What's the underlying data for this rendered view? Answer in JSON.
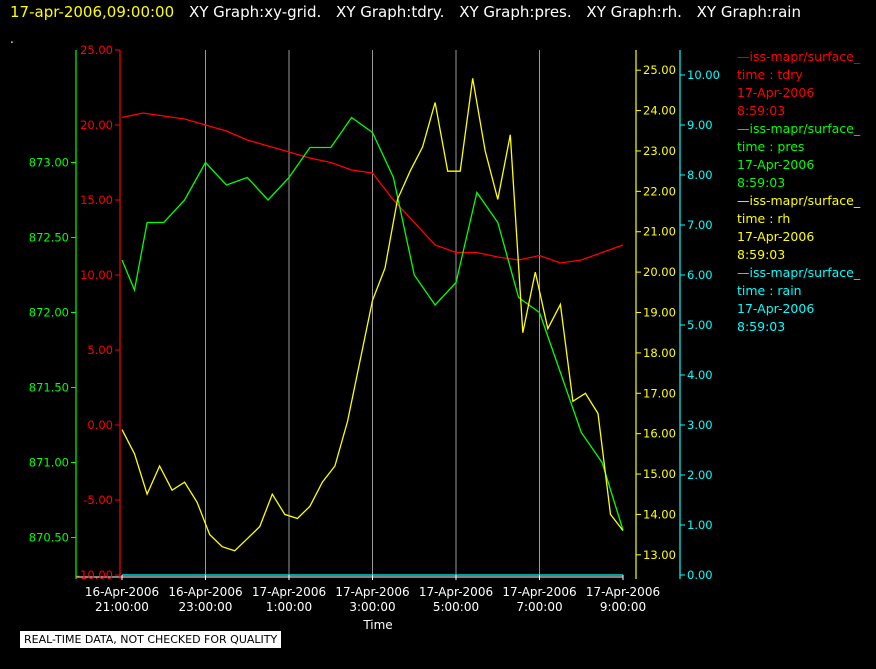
{
  "header": {
    "timestamp": "17-apr-2006,09:00:00",
    "graphs": [
      "XY Graph:xy-grid.",
      "XY Graph:tdry.",
      "XY Graph:pres.",
      "XY Graph:rh.",
      "XY Graph:rain"
    ],
    "subline": "."
  },
  "footer": {
    "quality_note": "REAL-TIME DATA, NOT CHECKED FOR QUALITY"
  },
  "colors": {
    "tdry": "#ff0000",
    "pres": "#00ff00",
    "rh": "#ffff00",
    "rain": "#00ffff",
    "grid": "#999999",
    "axis_text": "#ffffff"
  },
  "legend": [
    {
      "series": "tdry",
      "lines": [
        "—iss-mapr/surface_",
        "time : tdry",
        "17-Apr-2006",
        "8:59:03"
      ]
    },
    {
      "series": "pres",
      "lines": [
        "—iss-mapr/surface_",
        "time : pres",
        "17-Apr-2006",
        "8:59:03"
      ]
    },
    {
      "series": "rh",
      "lines": [
        "—iss-mapr/surface_",
        "time : rh",
        "17-Apr-2006",
        "8:59:03"
      ]
    },
    {
      "series": "rain",
      "lines": [
        "—iss-mapr/surface_",
        "time : rain",
        "17-Apr-2006",
        "8:59:03"
      ]
    }
  ],
  "chart_data": {
    "type": "line",
    "xlabel": "Time",
    "x_ticks": [
      [
        "16-Apr-2006",
        "21:00:00"
      ],
      [
        "16-Apr-2006",
        "23:00:00"
      ],
      [
        "17-Apr-2006",
        "1:00:00"
      ],
      [
        "17-Apr-2006",
        "3:00:00"
      ],
      [
        "17-Apr-2006",
        "5:00:00"
      ],
      [
        "17-Apr-2006",
        "7:00:00"
      ],
      [
        "17-Apr-2006",
        "9:00:00"
      ]
    ],
    "x_range_hours": [
      0,
      12
    ],
    "axes": {
      "pres": {
        "ylim": [
          870.25,
          873.75
        ],
        "ticks": [
          "870.50",
          "871.00",
          "871.50",
          "872.00",
          "872.50",
          "873.00"
        ]
      },
      "tdry": {
        "ylim": [
          -10,
          25
        ],
        "ticks": [
          "-10.00",
          "-5.00",
          "0.00",
          "5.00",
          "10.00",
          "15.00",
          "20.00",
          "25.00"
        ]
      },
      "rh": {
        "ylim": [
          12.5,
          25.5
        ],
        "ticks": [
          "13.00",
          "14.00",
          "15.00",
          "16.00",
          "17.00",
          "18.00",
          "19.00",
          "20.00",
          "21.00",
          "22.00",
          "23.00",
          "24.00",
          "25.00"
        ]
      },
      "rain": {
        "ylim": [
          0,
          10.5
        ],
        "ticks": [
          "0.00",
          "1.00",
          "2.00",
          "3.00",
          "4.00",
          "5.00",
          "6.00",
          "7.00",
          "8.00",
          "9.00",
          "10.00"
        ]
      }
    },
    "grid": true,
    "series": [
      {
        "name": "tdry",
        "axis": "tdry",
        "x": [
          0,
          0.5,
          1,
          1.5,
          2,
          2.5,
          3,
          3.5,
          4,
          4.5,
          5,
          5.5,
          6,
          6.5,
          7,
          7.5,
          8,
          8.5,
          9,
          9.5,
          10,
          10.5,
          11,
          11.5,
          12
        ],
        "values": [
          20.5,
          20.8,
          20.6,
          20.4,
          20.0,
          19.6,
          19.0,
          18.6,
          18.2,
          17.8,
          17.5,
          17.0,
          16.8,
          15.0,
          13.5,
          12.0,
          11.5,
          11.5,
          11.2,
          11.0,
          11.3,
          10.8,
          11.0,
          11.5,
          12.0
        ]
      },
      {
        "name": "pres",
        "axis": "pres",
        "x": [
          0,
          0.3,
          0.6,
          1,
          1.5,
          2,
          2.5,
          3,
          3.5,
          4,
          4.5,
          5,
          5.5,
          6,
          6.5,
          7,
          7.5,
          8,
          8.5,
          9,
          9.5,
          10,
          10.5,
          11,
          11.5,
          12
        ],
        "values": [
          872.35,
          872.15,
          872.6,
          872.6,
          872.75,
          873.0,
          872.85,
          872.9,
          872.75,
          872.9,
          873.1,
          873.1,
          873.3,
          873.2,
          872.9,
          872.25,
          872.05,
          872.2,
          872.8,
          872.6,
          872.1,
          872.0,
          871.6,
          871.2,
          871.0,
          870.55
        ]
      },
      {
        "name": "rh",
        "axis": "rh",
        "x": [
          0,
          0.3,
          0.6,
          0.9,
          1.2,
          1.5,
          1.8,
          2.1,
          2.4,
          2.7,
          3,
          3.3,
          3.6,
          3.9,
          4.2,
          4.5,
          4.8,
          5.1,
          5.4,
          5.7,
          6,
          6.3,
          6.6,
          6.9,
          7.2,
          7.5,
          7.8,
          8.1,
          8.4,
          8.7,
          9,
          9.3,
          9.6,
          9.9,
          10.2,
          10.5,
          10.8,
          11.1,
          11.4,
          11.7,
          12
        ],
        "values": [
          16.1,
          15.5,
          14.5,
          15.2,
          14.6,
          14.8,
          14.3,
          13.5,
          13.2,
          13.1,
          13.4,
          13.7,
          14.5,
          14.0,
          13.9,
          14.2,
          14.8,
          15.2,
          16.3,
          17.8,
          19.3,
          20.1,
          21.8,
          22.5,
          23.1,
          24.2,
          22.5,
          22.5,
          24.8,
          23.0,
          21.8,
          23.4,
          18.5,
          20.0,
          18.6,
          19.2,
          16.8,
          17.0,
          16.5,
          14.0,
          13.6
        ]
      },
      {
        "name": "rain",
        "axis": "rain",
        "x": [
          0,
          12
        ],
        "values": [
          0,
          0
        ]
      }
    ]
  }
}
